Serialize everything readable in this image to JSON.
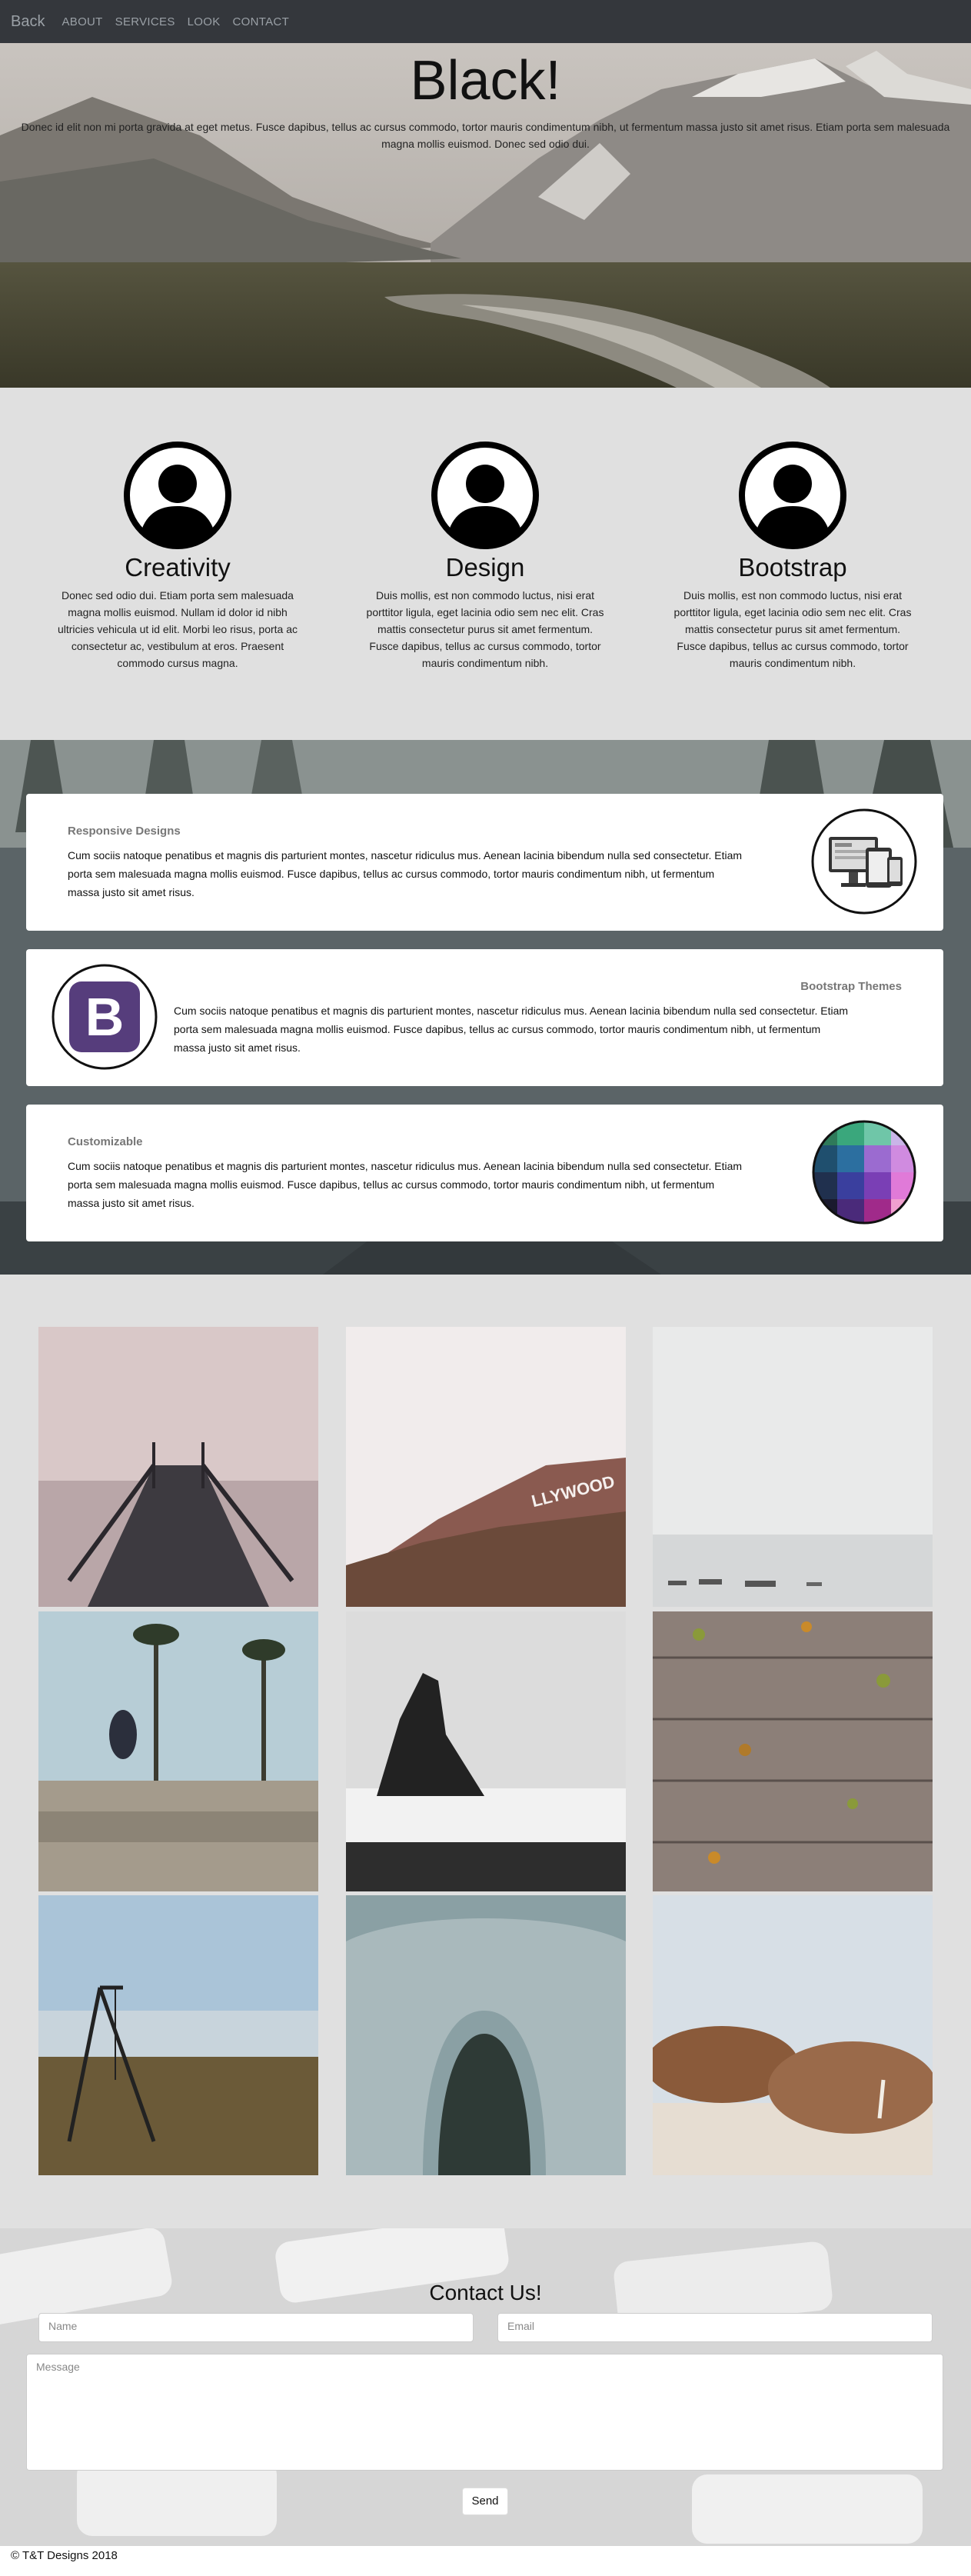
{
  "nav": {
    "brand": "Back",
    "links": [
      "ABOUT",
      "SERVICES",
      "LOOK",
      "CONTACT"
    ]
  },
  "hero": {
    "title": "Black!",
    "text": "Donec id elit non mi porta gravida at eget metus. Fusce dapibus, tellus ac cursus commodo, tortor mauris condimentum nibh, ut fermentum massa justo sit amet risus. Etiam porta sem malesuada magna mollis euismod. Donec sed odio dui."
  },
  "features": [
    {
      "title": "Creativity",
      "text": "Donec sed odio dui. Etiam porta sem malesuada magna mollis euismod. Nullam id dolor id nibh ultricies vehicula ut id elit. Morbi leo risus, porta ac consectetur ac, vestibulum at eros. Praesent commodo cursus magna."
    },
    {
      "title": "Design",
      "text": "Duis mollis, est non commodo luctus, nisi erat porttitor ligula, eget lacinia odio sem nec elit. Cras mattis consectetur purus sit amet fermentum. Fusce dapibus, tellus ac cursus commodo, tortor mauris condimentum nibh."
    },
    {
      "title": "Bootstrap",
      "text": "Duis mollis, est non commodo luctus, nisi erat porttitor ligula, eget lacinia odio sem nec elit. Cras mattis consectetur purus sit amet fermentum. Fusce dapibus, tellus ac cursus commodo, tortor mauris condimentum nibh."
    }
  ],
  "cards": [
    {
      "title": "Responsive Designs",
      "text": "Cum sociis natoque penatibus et magnis dis parturient montes, nascetur ridiculus mus. Aenean lacinia bibendum nulla sed consectetur. Etiam porta sem malesuada magna mollis euismod. Fusce dapibus, tellus ac cursus commodo, tortor mauris condimentum nibh, ut fermentum massa justo sit amet risus.",
      "icon": "devices-icon"
    },
    {
      "title": "Bootstrap Themes",
      "text": "Cum sociis natoque penatibus et magnis dis parturient montes, nascetur ridiculus mus. Aenean lacinia bibendum nulla sed consectetur. Etiam porta sem malesuada magna mollis euismod. Fusce dapibus, tellus ac cursus commodo, tortor mauris condimentum nibh, ut fermentum massa justo sit amet risus.",
      "icon": "bootstrap-logo-icon",
      "logo_letter": "B"
    },
    {
      "title": "Customizable",
      "text": "Cum sociis natoque penatibus et magnis dis parturient montes, nascetur ridiculus mus. Aenean lacinia bibendum nulla sed consectetur. Etiam porta sem malesuada magna mollis euismod. Fusce dapibus, tellus ac cursus commodo, tortor mauris condimentum nibh, ut fermentum massa justo sit amet risus.",
      "icon": "color-palette-icon"
    }
  ],
  "gallery": {
    "photos": [
      "pier-photo",
      "hollywood-hills-photo",
      "foggy-boats-photo",
      "skateboarder-photo",
      "sea-rock-photo",
      "wooden-deck-leaves-photo",
      "swing-photo",
      "rock-arch-photo",
      "walrus-photo"
    ],
    "photo_sign_text": "LLYWOOD"
  },
  "contact": {
    "title": "Contact Us!",
    "name_placeholder": "Name",
    "email_placeholder": "Email",
    "message_placeholder": "Message",
    "send_label": "Send"
  },
  "footer": {
    "text": "© T&T Designs 2018"
  },
  "colors": {
    "nav_bg": "#34373c",
    "page_bg": "#e0e0e0",
    "bootstrap_purple": "#563d7c"
  }
}
